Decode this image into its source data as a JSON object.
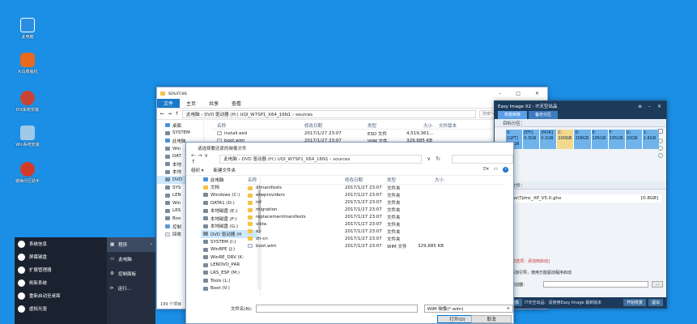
{
  "desktop": {
    "icons": [
      {
        "label": "此电脑",
        "color": "#2a8fe0"
      },
      {
        "label": "大白菜装机",
        "color": "#e76a1f"
      },
      {
        "label": "EIX系统安装",
        "color": "#c94434"
      },
      {
        "label": "Win系统安装",
        "color": "#9fc9e9"
      },
      {
        "label": "傲梅分区助手",
        "color": "#d43a2a"
      }
    ]
  },
  "explorer": {
    "title": "sources",
    "ribbon": [
      "文件",
      "主页",
      "共享",
      "查看"
    ],
    "address": "此电脑 › DVD 驱动器 (H:) UQI_W7SP1_X64_16N1 › sources",
    "search_placeholder": "搜索\"sources\"",
    "nav": [
      "桌面",
      "SYSTEM",
      "此电脑",
      "Win",
      "DAT",
      "本地",
      "本地",
      "DVD",
      "SYS",
      "LEN",
      "Win",
      "LRS",
      "Boo",
      "控制",
      "回收"
    ],
    "columns": [
      "名称",
      "修改日期",
      "类型",
      "大小",
      "文件版本"
    ],
    "rows": [
      {
        "name": "install.esd",
        "date": "2017/1/27 23:07",
        "type": "ESD 文件",
        "size": "4,519,361..."
      },
      {
        "name": "boot.wim",
        "date": "2017/1/27 23:07",
        "type": "WIM 文件",
        "size": "329,685 KB"
      }
    ],
    "status": "199 个项目"
  },
  "dialog": {
    "title": "请选择要还原的映像文件",
    "nav_arrows": "←  →  ∨  ↑",
    "address": "此电脑 › DVD 驱动器 (H:) UQI_W7SP1_X64_16N1 › sources",
    "toolbar": [
      "组织 ▾",
      "新建文件夹"
    ],
    "nav": [
      "此电脑",
      "文档",
      "Windows (C:)",
      "DATA1 (D:)",
      "本地磁盘 (E:)",
      "本地磁盘 (F:)",
      "本地磁盘 (G:)",
      "DVD 驱动器 (H",
      "SYSTEM (I:)",
      "Win8PE (J:)",
      "WinRE_DRV (K:",
      "LENOVO_PAR",
      "LRS_ESP (M:)",
      "Tools (L:)",
      "Boot (V:)"
    ],
    "columns": [
      "名称",
      "修改日期",
      "类型",
      "大小"
    ],
    "rows": [
      {
        "name": "dlmanifests",
        "date": "2017/1/27 23:07",
        "type": "文件夹",
        "size": "",
        "kind": "folder"
      },
      {
        "name": "etwproviders",
        "date": "2017/1/27 23:07",
        "type": "文件夹",
        "size": "",
        "kind": "folder"
      },
      {
        "name": "inf",
        "date": "2017/1/27 23:07",
        "type": "文件夹",
        "size": "",
        "kind": "folder"
      },
      {
        "name": "migration",
        "date": "2017/1/27 23:07",
        "type": "文件夹",
        "size": "",
        "kind": "folder"
      },
      {
        "name": "replacementmanifests",
        "date": "2017/1/27 23:07",
        "type": "文件夹",
        "size": "",
        "kind": "folder"
      },
      {
        "name": "vista",
        "date": "2017/1/27 23:07",
        "type": "文件夹",
        "size": "",
        "kind": "folder"
      },
      {
        "name": "xp",
        "date": "2017/1/27 23:07",
        "type": "文件夹",
        "size": "",
        "kind": "folder"
      },
      {
        "name": "zh-cn",
        "date": "2017/1/27 23:07",
        "type": "文件夹",
        "size": "",
        "kind": "folder"
      },
      {
        "name": "boot.wim",
        "date": "2017/1/27 23:07",
        "type": "WIM 文件",
        "size": "329,685 KB",
        "kind": "file"
      }
    ],
    "filename_label": "文件名(N):",
    "filetype": "WIM 映像(*.wim)",
    "open_label": "打开(O)",
    "cancel_label": "取消"
  },
  "easyimage": {
    "title": "Easy Image X2 - IT天空出品",
    "controls": [
      "≡",
      "–",
      "×"
    ],
    "tabs": [
      "恢复映像",
      "备份分区"
    ],
    "section_target": "目标分区：",
    "partitions": [
      {
        "line1": "0:[GPT]",
        "line2": "0.1GB"
      },
      {
        "line1": "[EFI]",
        "line2": "0.3GB"
      },
      {
        "line1": "[MSR]",
        "line2": "0.1GB"
      },
      {
        "line1": "C:",
        "line2": "100GB"
      },
      {
        "line1": "D:",
        "line2": "208GB"
      },
      {
        "line1": "E:",
        "line2": "195GB"
      },
      {
        "line1": "F:",
        "line2": "195GB"
      },
      {
        "line1": "G:",
        "line2": "20GB"
      },
      {
        "line1": "1:",
        "line2": "1.6GB"
      }
    ],
    "section_image": "映像文件：",
    "image_path": "gho\\Tjdnc_XP_V5.0.gho",
    "image_size": "[0.8GB]",
    "add_boot_text": "[当前选项：添加到启动]",
    "option1": "添加引导，使用万能驱动程序启动",
    "option2": "驱动器：",
    "footer_mode": "恢复映像",
    "footer_note": "IT天空出品：请使用Easy Image 最新版本",
    "footer_buttons": [
      "开始恢复",
      "退出"
    ]
  },
  "start_menu": {
    "items": [
      "系统信息",
      "屏幕键盘",
      "扩展管理器",
      "刷新系统",
      "重新启动至桌面",
      "虚拟光驱"
    ],
    "submenu": [
      "程序",
      "此电脑",
      "控制面板",
      "运行..."
    ]
  }
}
